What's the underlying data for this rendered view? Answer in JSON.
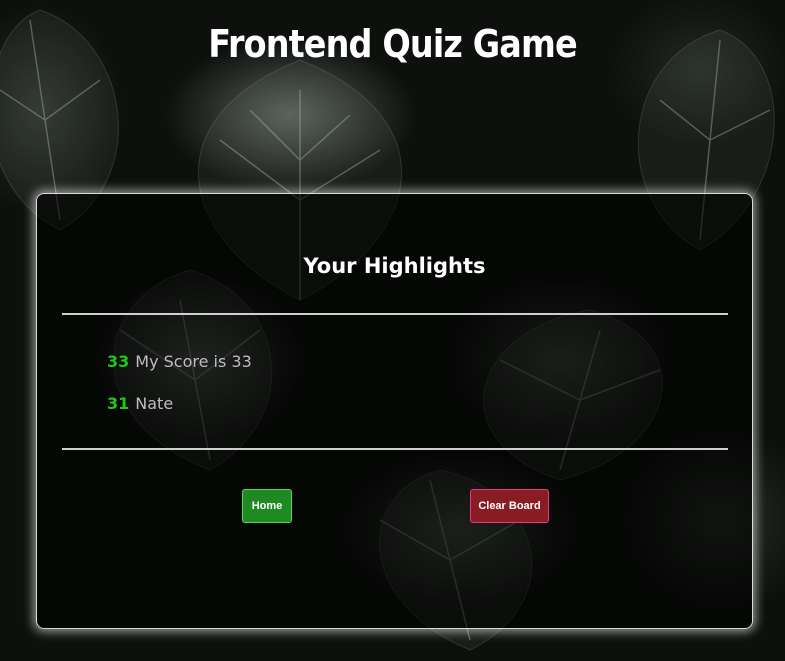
{
  "app": {
    "title": "Frontend Quiz Game"
  },
  "highlights": {
    "heading": "Your Highlights",
    "scores": [
      {
        "score": "33",
        "name": "My Score is 33"
      },
      {
        "score": "31",
        "name": "Nate"
      }
    ]
  },
  "actions": {
    "home_label": "Home",
    "clear_label": "Clear Board"
  },
  "colors": {
    "score_accent": "#22c41c",
    "home_button": "#1f8a22",
    "clear_button": "#8a1c24",
    "clear_button_border": "#e03a8a",
    "background": "#0d100d"
  }
}
